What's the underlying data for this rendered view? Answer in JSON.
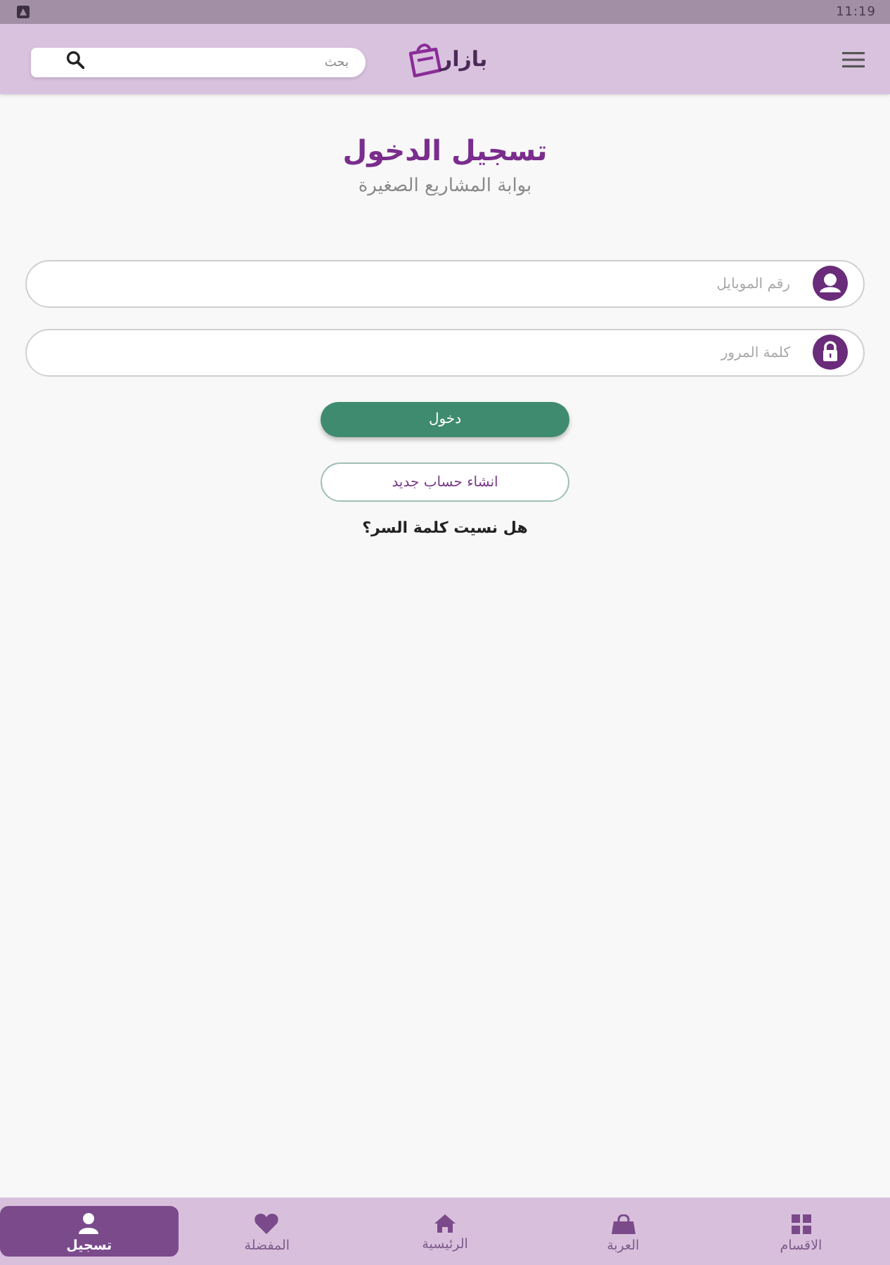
{
  "status_bar": {
    "time": "11:19"
  },
  "header": {
    "search": {
      "placeholder": "بحث"
    },
    "logo": {
      "text": "بازار"
    }
  },
  "title": "تسجيل الدخول",
  "subtitle": "بوابة المشاريع الصغيرة",
  "fields": [
    {
      "kind": "phone",
      "placeholder": "رقم الموبايل"
    },
    {
      "kind": "password",
      "placeholder": "كلمة المرور"
    }
  ],
  "buttons": [
    {
      "kind": "primary",
      "label": "دخول"
    },
    {
      "kind": "outline",
      "label": "انشاء حساب جديد"
    }
  ],
  "forgot_link": "هل نسيت كلمة السر؟",
  "bottom_nav": [
    {
      "kind": "categories",
      "label": "الاقسام",
      "selected": false
    },
    {
      "kind": "cart",
      "label": "العربة",
      "selected": false
    },
    {
      "kind": "home",
      "label": "الرئيسية",
      "selected": false
    },
    {
      "kind": "favorites",
      "label": "المفضلة",
      "selected": false
    },
    {
      "kind": "account",
      "label": "تسجيل",
      "selected": true
    }
  ]
}
